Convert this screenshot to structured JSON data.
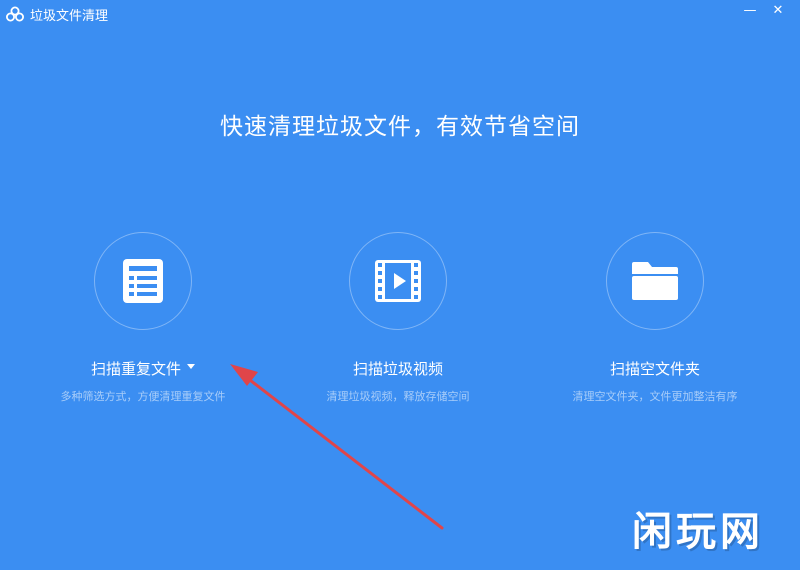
{
  "window": {
    "title": "垃圾文件清理",
    "min_glyph": "—",
    "close_glyph": "✕"
  },
  "headline": "快速清理垃圾文件，有效节省空间",
  "options": [
    {
      "label": "扫描重复文件",
      "description": "多种筛选方式，方便清理重复文件",
      "icon": "document-list-icon",
      "has_dropdown": true
    },
    {
      "label": "扫描垃圾视频",
      "description": "清理垃圾视频，释放存储空间",
      "icon": "video-film-icon",
      "has_dropdown": false
    },
    {
      "label": "扫描空文件夹",
      "description": "清理空文件夹，文件更加整洁有序",
      "icon": "folder-icon",
      "has_dropdown": false
    }
  ],
  "watermark": "闲玩网",
  "colors": {
    "background": "#3b8ef2",
    "icon_fill": "#ffffff",
    "icon_detail": "#3b8ef2",
    "annotation_arrow": "#e0454a"
  }
}
